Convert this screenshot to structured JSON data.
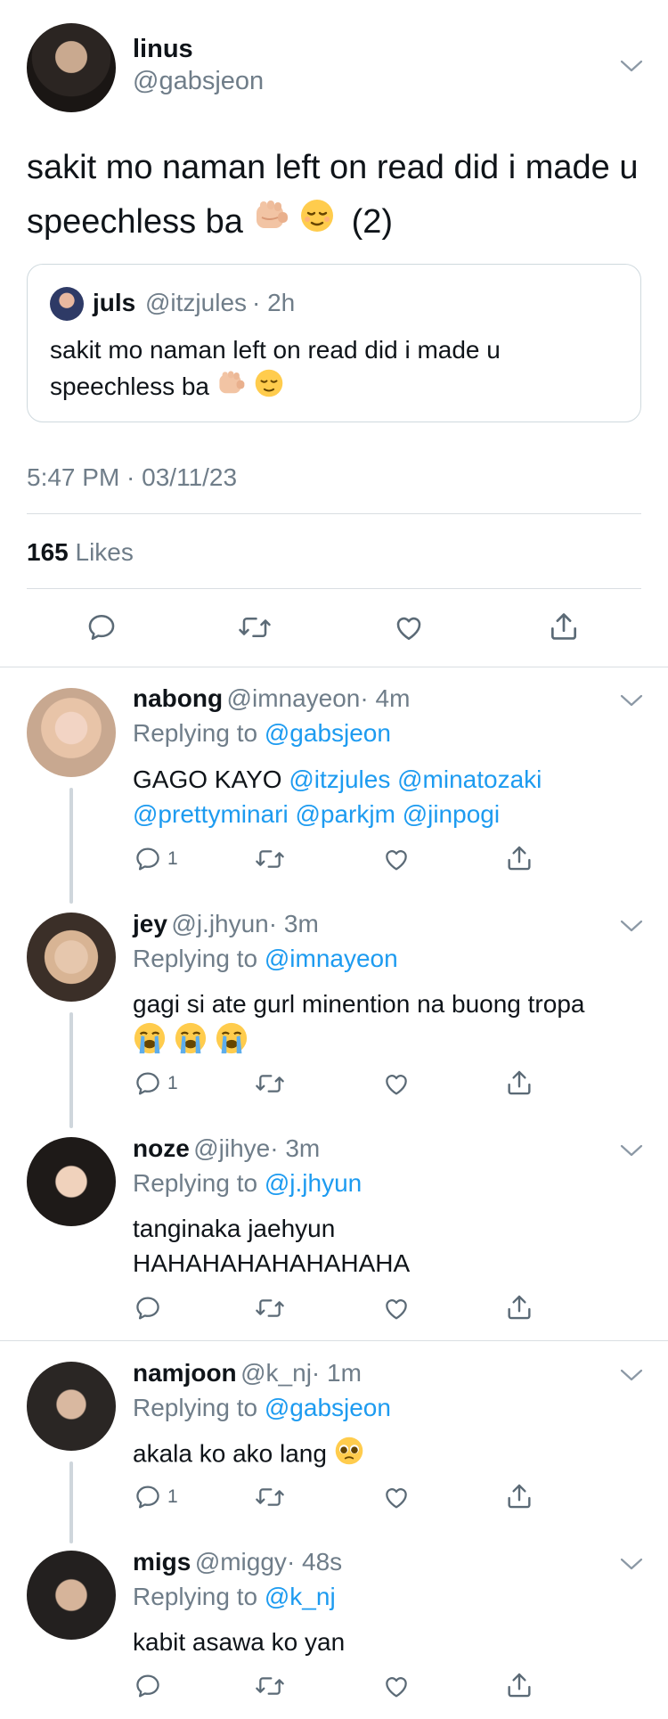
{
  "tweet": {
    "name": "linus",
    "handle": "@gabsjeon",
    "text": "sakit mo naman left on read did i made u speechless ba",
    "text_suffix": "(2)",
    "quote": {
      "name": "juls",
      "handle": "@itzjules",
      "time": "· 2h",
      "text": "sakit mo naman left on read did i made u speechless ba"
    },
    "timestamp": "5:47 PM · 03/11/23",
    "likes_count": "165",
    "likes_label": "Likes"
  },
  "replies": [
    {
      "name": "nabong",
      "handle": "@imnayeon",
      "time": "· 4m",
      "replying_prefix": "Replying to",
      "replying_to": "@gabsjeon",
      "mentions_line1": [
        "@itzjules",
        "@minatozaki"
      ],
      "mentions_line2": [
        "@prettyminari",
        "@parkjm",
        "@jinpogi"
      ],
      "text": "GAGO KAYO",
      "reply_count": "1"
    },
    {
      "name": "jey",
      "handle": "@j.jhyun",
      "time": "· 3m",
      "replying_prefix": "Replying to",
      "replying_to": "@imnayeon",
      "text": "gagi si ate gurl minention na buong tropa",
      "reply_count": "1"
    },
    {
      "name": "noze",
      "handle": "@jihye",
      "time": "· 3m",
      "replying_prefix": "Replying to",
      "replying_to": "@j.jhyun",
      "text_line1": "tanginaka jaehyun",
      "text_line2": "HAHAHAHAHAHAHAHA",
      "reply_count": ""
    },
    {
      "name": "namjoon",
      "handle": "@k_nj",
      "time": "· 1m",
      "replying_prefix": "Replying to",
      "replying_to": "@gabsjeon",
      "text": "akala ko ako lang",
      "reply_count": "1"
    },
    {
      "name": "migs",
      "handle": "@miggy",
      "time": "· 48s",
      "replying_prefix": "Replying to",
      "replying_to": "@k_nj",
      "text": "kabit asawa ko yan",
      "reply_count": ""
    }
  ],
  "colors": {
    "link": "#1d9bf0",
    "muted": "#6f7d89",
    "divider": "#d9dee2"
  },
  "icons": [
    "reply-icon",
    "retweet-icon",
    "like-icon",
    "share-icon",
    "chevron-down-icon",
    "fist-emoji",
    "relieved-emoji",
    "crying-emoji",
    "pleading-emoji"
  ]
}
